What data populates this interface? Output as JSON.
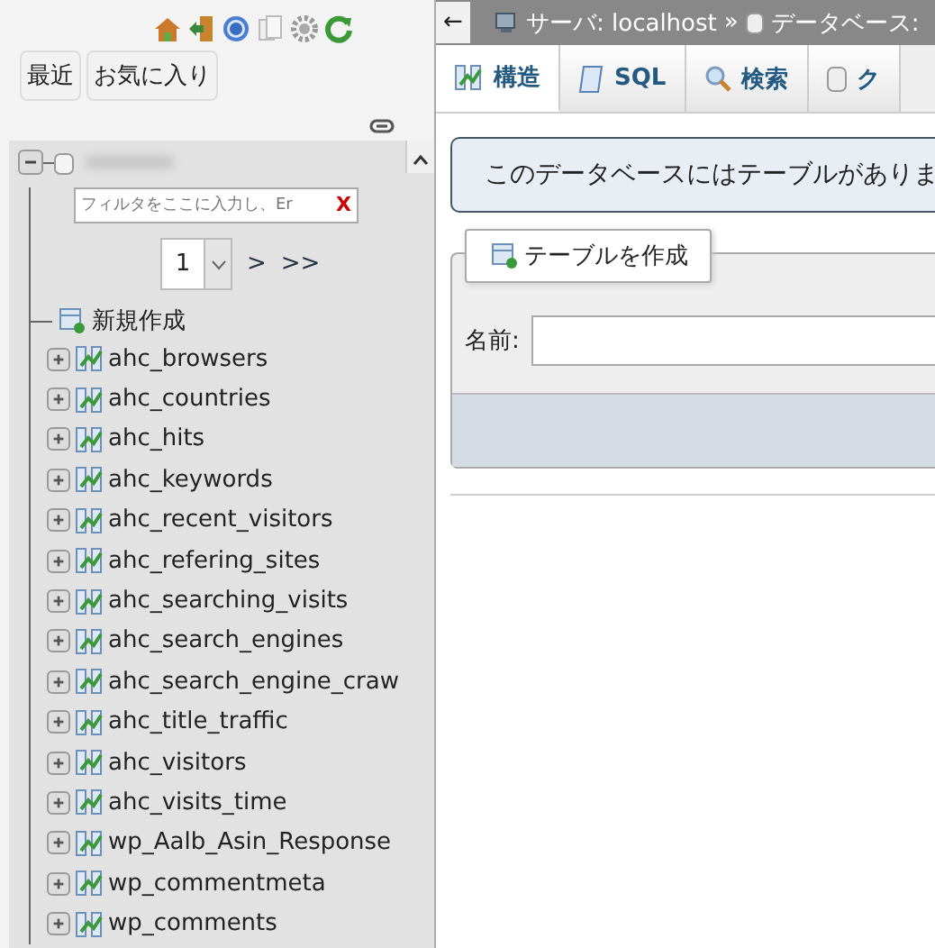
{
  "nav_buttons": [
    {
      "label": "最近"
    },
    {
      "label": "お気に入り"
    }
  ],
  "tree": {
    "expanded": true,
    "filter": {
      "placeholder": "フィルタをここに入力し、Er",
      "clear": "X"
    },
    "pager": {
      "page": "1",
      "next": ">",
      "last": ">>"
    },
    "new_item": "新規作成",
    "tables": [
      "ahc_browsers",
      "ahc_countries",
      "ahc_hits",
      "ahc_keywords",
      "ahc_recent_visitors",
      "ahc_refering_sites",
      "ahc_searching_visits",
      "ahc_search_engines",
      "ahc_search_engine_craw",
      "ahc_title_traffic",
      "ahc_visitors",
      "ahc_visits_time",
      "wp_Aalb_Asin_Response",
      "wp_commentmeta",
      "wp_comments"
    ]
  },
  "breadcrumb": {
    "back": "←",
    "server": "サーバ: localhost",
    "sep": "»",
    "database": "データベース:"
  },
  "tabs": [
    {
      "label": "構造",
      "kind": "structure",
      "selected": true
    },
    {
      "label": "SQL",
      "kind": "sql",
      "selected": false
    },
    {
      "label": "検索",
      "kind": "search",
      "selected": false
    },
    {
      "label": "ク",
      "kind": "query",
      "selected": false
    }
  ],
  "notice": "このデータベースにはテーブルがありま",
  "create_table": {
    "legend": "テーブルを作成",
    "name_label": "名前:"
  }
}
